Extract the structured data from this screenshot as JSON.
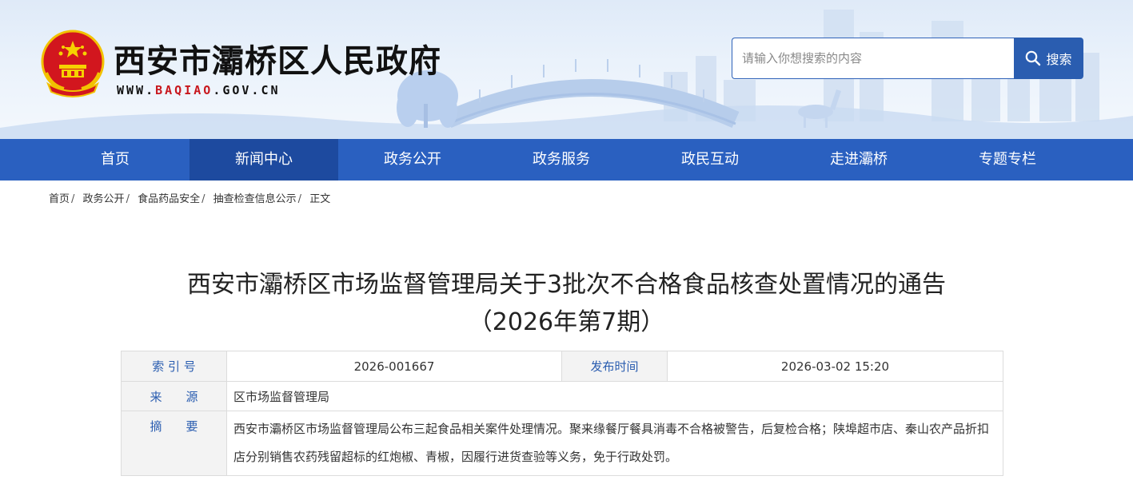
{
  "header": {
    "site_title": "西安市灞桥区人民政府",
    "site_url_prefix": "WWW.",
    "site_url_accent": "BAQIAO",
    "site_url_suffix": ".GOV.CN",
    "emblem_icon": "national-emblem-icon",
    "accent_color": "#c8171d"
  },
  "search": {
    "placeholder": "请输入你想搜索的内容",
    "button_label": "搜索",
    "icon": "search-icon"
  },
  "nav": {
    "items": [
      {
        "label": "首页"
      },
      {
        "label": "新闻中心",
        "active": true
      },
      {
        "label": "政务公开"
      },
      {
        "label": "政务服务"
      },
      {
        "label": "政民互动"
      },
      {
        "label": "走进灞桥"
      },
      {
        "label": "专题专栏"
      }
    ],
    "color": "#2a60c0",
    "active_color": "#1d4a9f"
  },
  "breadcrumb": {
    "items": [
      "首页",
      "政务公开",
      "食品药品安全",
      "抽查检查信息公示",
      "正文"
    ],
    "separator": "/"
  },
  "article": {
    "title_line1": "西安市灞桥区市场监督管理局关于3批次不合格食品核查处置情况的通告",
    "title_line2": "（2026年第7期）"
  },
  "meta": {
    "index_label": "索 引 号",
    "index_value": "2026-001667",
    "publish_label": "发布时间",
    "publish_value": "2026-03-02 15:20",
    "source_label": "来　　源",
    "source_value": "区市场监督管理局",
    "summary_label": "摘　　要",
    "summary_value": "西安市灞桥区市场监督管理局公布三起食品相关案件处理情况。聚来缘餐厅餐具消毒不合格被警告，后复检合格；陕埠超市店、秦山农产品折扣店分别销售农药残留超标的红炮椒、青椒，因履行进货查验等义务，免于行政处罚。"
  }
}
